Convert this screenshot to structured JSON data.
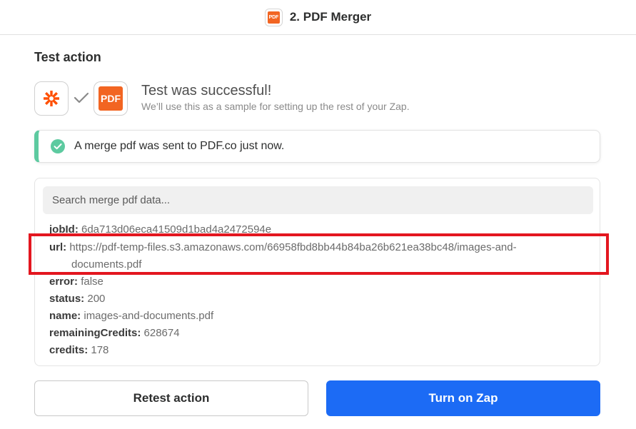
{
  "header": {
    "logo_text": "PDF",
    "title": "2. PDF Merger"
  },
  "section": {
    "title": "Test action"
  },
  "icons": {
    "zapier": "zapier-asterisk-icon",
    "check": "check-icon",
    "app_logo_text": "PDF"
  },
  "result": {
    "title": "Test was successful!",
    "subtitle": "We’ll use this as a sample for setting up the rest of your Zap."
  },
  "alert": {
    "text": "A merge pdf was sent to PDF.co just now.",
    "accent_color": "#5dcaa0"
  },
  "data_panel": {
    "search_placeholder": "Search merge pdf data...",
    "fields": {
      "jobId": {
        "key": "jobId:",
        "value": "6da713d06eca41509d1bad4a2472594e"
      },
      "url": {
        "key": "url:",
        "value_line1": "https://pdf-temp-files.s3.amazonaws.com/66958fbd8bb44b84ba26b621ea38bc48/images-and-",
        "value_line2": "documents.pdf"
      },
      "error": {
        "key": "error:",
        "value": "false"
      },
      "status": {
        "key": "status:",
        "value": "200"
      },
      "name": {
        "key": "name:",
        "value": "images-and-documents.pdf"
      },
      "remainingCredits": {
        "key": "remainingCredits:",
        "value": "628674"
      },
      "credits": {
        "key": "credits:",
        "value": "178"
      }
    }
  },
  "highlight_color": "#e3161f",
  "buttons": {
    "retest": "Retest action",
    "turn_on": "Turn on Zap",
    "primary_color": "#1c6bf5"
  }
}
